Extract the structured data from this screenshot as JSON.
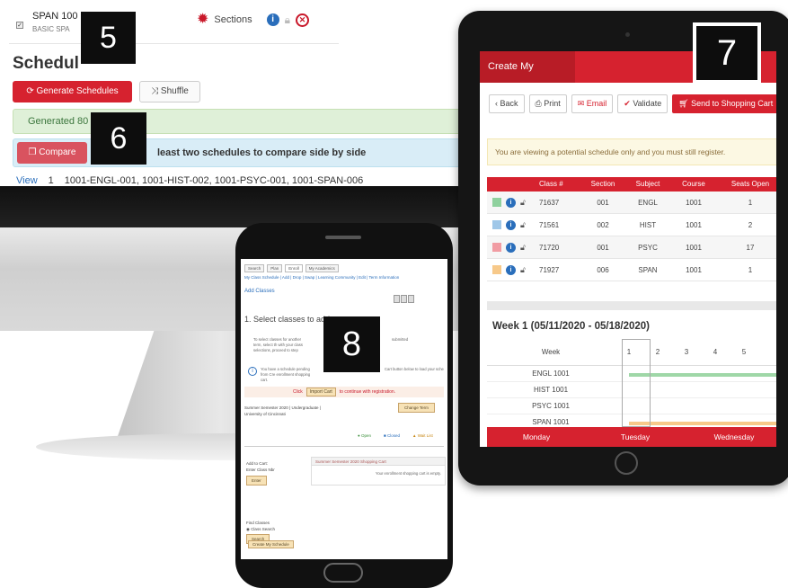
{
  "monitor": {
    "course_code": "SPAN 100",
    "course_desc": "BASIC SPA",
    "sections_label": "Sections",
    "schedule_heading": "Schedul",
    "generate_label": "Generate Schedules",
    "shuffle_label": "Shuffle",
    "generated_text": "Generated 80",
    "compare_label": "Compare",
    "compare_hint": "least two schedules to compare side by side",
    "row": {
      "view": "View",
      "num": "1",
      "courses": "1001-ENGL-001, 1001-HIST-002, 1001-PSYC-001, 1001-SPAN-006"
    }
  },
  "markers": {
    "m5": "5",
    "m6": "6",
    "m7": "7",
    "m8": "8"
  },
  "tablet": {
    "header_title": "Create My Schedule",
    "toolbar": {
      "back": "Back",
      "print": "Print",
      "email": "Email",
      "validate": "Validate",
      "send": "Send to Shopping Cart"
    },
    "notice": "You are viewing a potential schedule only and you must still register.",
    "columns": {
      "class": "Class #",
      "section": "Section",
      "subject": "Subject",
      "course": "Course",
      "seats": "Seats Open"
    },
    "rows": [
      {
        "color": "#8fd19e",
        "class": "71637",
        "section": "001",
        "subject": "ENGL",
        "course": "1001",
        "seats": "1"
      },
      {
        "color": "#9fc7e8",
        "class": "71561",
        "section": "002",
        "subject": "HIST",
        "course": "1001",
        "seats": "2"
      },
      {
        "color": "#f19ca3",
        "class": "71720",
        "section": "001",
        "subject": "PSYC",
        "course": "1001",
        "seats": "17"
      },
      {
        "color": "#f7c98a",
        "class": "71927",
        "section": "006",
        "subject": "SPAN",
        "course": "1001",
        "seats": "1"
      }
    ],
    "week_title": "Week 1 (05/11/2020 - 05/18/2020)",
    "week_label": "Week",
    "week_days": [
      "1",
      "2",
      "3",
      "4",
      "5"
    ],
    "cal_rows": [
      "ENGL 1001",
      "HIST 1001",
      "PSYC 1001",
      "SPAN 1001"
    ],
    "days": [
      "Monday",
      "Tuesday",
      "Wednesday"
    ]
  },
  "phone": {
    "tabs": [
      "Search",
      "Plan",
      "Enroll",
      "My Academics"
    ],
    "sub_nav": "My Class Schedule | Add | Drop | Swap | Learning Community | Edit | Term Information",
    "add_classes": "Add Classes",
    "step_title": "1.  Select classes to add",
    "text_left": "To select classes for another term, select th with your class selections, proceed to step",
    "text_right": "submitted",
    "info_text": "You have a schedule pending from Cre enrollment shopping cart.",
    "info_text_right": "Cart button below to load your sche",
    "click_prefix": "Click",
    "import_cart": "Import Cart",
    "click_suffix": "to continue with registration.",
    "term": "Summer Semester 2020 | Undergraduate | University of Cincinnati",
    "change_term": "Change Term",
    "legend": {
      "open": "Open",
      "closed": "Closed",
      "wait": "Wait List"
    },
    "add_to_cart": "Add to Cart:",
    "enter_class_nbr": "Enter Class Nbr",
    "enter_btn": "Enter",
    "cart_header": "Summer Semester 2020 Shopping Cart",
    "cart_empty": "Your enrollment shopping cart is empty.",
    "find_classes": "Find Classes",
    "class_search": "Class Search",
    "search_btn": "Search",
    "create_schedule": "Create My Schedule"
  }
}
